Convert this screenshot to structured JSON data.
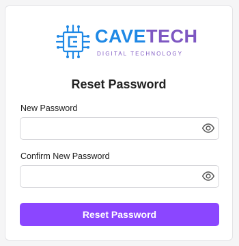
{
  "brand": {
    "name_part1": "CAVE",
    "name_part2": "TECH",
    "tagline": "DIGITAL TECHNOLOGY",
    "icon": "circuit-chip-logo-icon"
  },
  "form": {
    "title": "Reset Password",
    "new_password": {
      "label": "New Password",
      "value": "",
      "placeholder": ""
    },
    "confirm_password": {
      "label": "Confirm New Password",
      "value": "",
      "placeholder": ""
    },
    "submit_label": "Reset Password",
    "toggle_icon": "eye-icon"
  },
  "colors": {
    "brand_blue": "#1e88e5",
    "brand_purple": "#7e57c2",
    "button": "#8b46ff",
    "background": "#f5f5f6"
  }
}
